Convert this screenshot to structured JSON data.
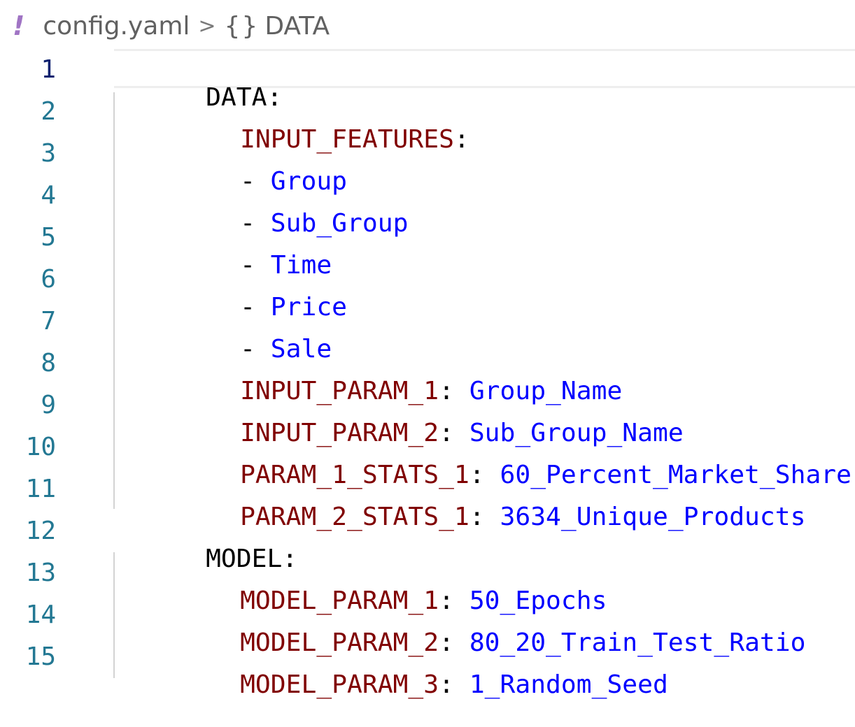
{
  "breadcrumb": {
    "file_icon": "!",
    "file_name": "config.yaml",
    "separator": ">",
    "symbol_icon": "{}",
    "symbol_name": "DATA"
  },
  "editor": {
    "lines": [
      {
        "number": "1",
        "key": "DATA",
        "sep": ":",
        "value": ""
      },
      {
        "number": "2",
        "key": "INPUT_FEATURES",
        "sep": ":",
        "value": ""
      },
      {
        "number": "3",
        "dash": "- ",
        "value": "Group"
      },
      {
        "number": "4",
        "dash": "- ",
        "value": "Sub_Group"
      },
      {
        "number": "5",
        "dash": "- ",
        "value": "Time"
      },
      {
        "number": "6",
        "dash": "- ",
        "value": "Price"
      },
      {
        "number": "7",
        "dash": "- ",
        "value": "Sale"
      },
      {
        "number": "8",
        "key": "INPUT_PARAM_1",
        "sep": ": ",
        "value": "Group_Name"
      },
      {
        "number": "9",
        "key": "INPUT_PARAM_2",
        "sep": ": ",
        "value": "Sub_Group_Name"
      },
      {
        "number": "10",
        "key": "PARAM_1_STATS_1",
        "sep": ": ",
        "value": "60_Percent_Market_Share"
      },
      {
        "number": "11",
        "key": "PARAM_2_STATS_1",
        "sep": ": ",
        "value": "3634_Unique_Products"
      },
      {
        "number": "12",
        "key": "MODEL",
        "sep": ":",
        "value": ""
      },
      {
        "number": "13",
        "key": "MODEL_PARAM_1",
        "sep": ": ",
        "value": "50_Epochs"
      },
      {
        "number": "14",
        "key": "MODEL_PARAM_2",
        "sep": ": ",
        "value": "80_20_Train_Test_Ratio"
      },
      {
        "number": "15",
        "key": "MODEL_PARAM_3",
        "sep": ": ",
        "value": "1_Random_Seed"
      }
    ]
  },
  "colors": {
    "line_number": "#237893",
    "key": "#800000",
    "value": "#0000ff",
    "plain": "#000000"
  }
}
